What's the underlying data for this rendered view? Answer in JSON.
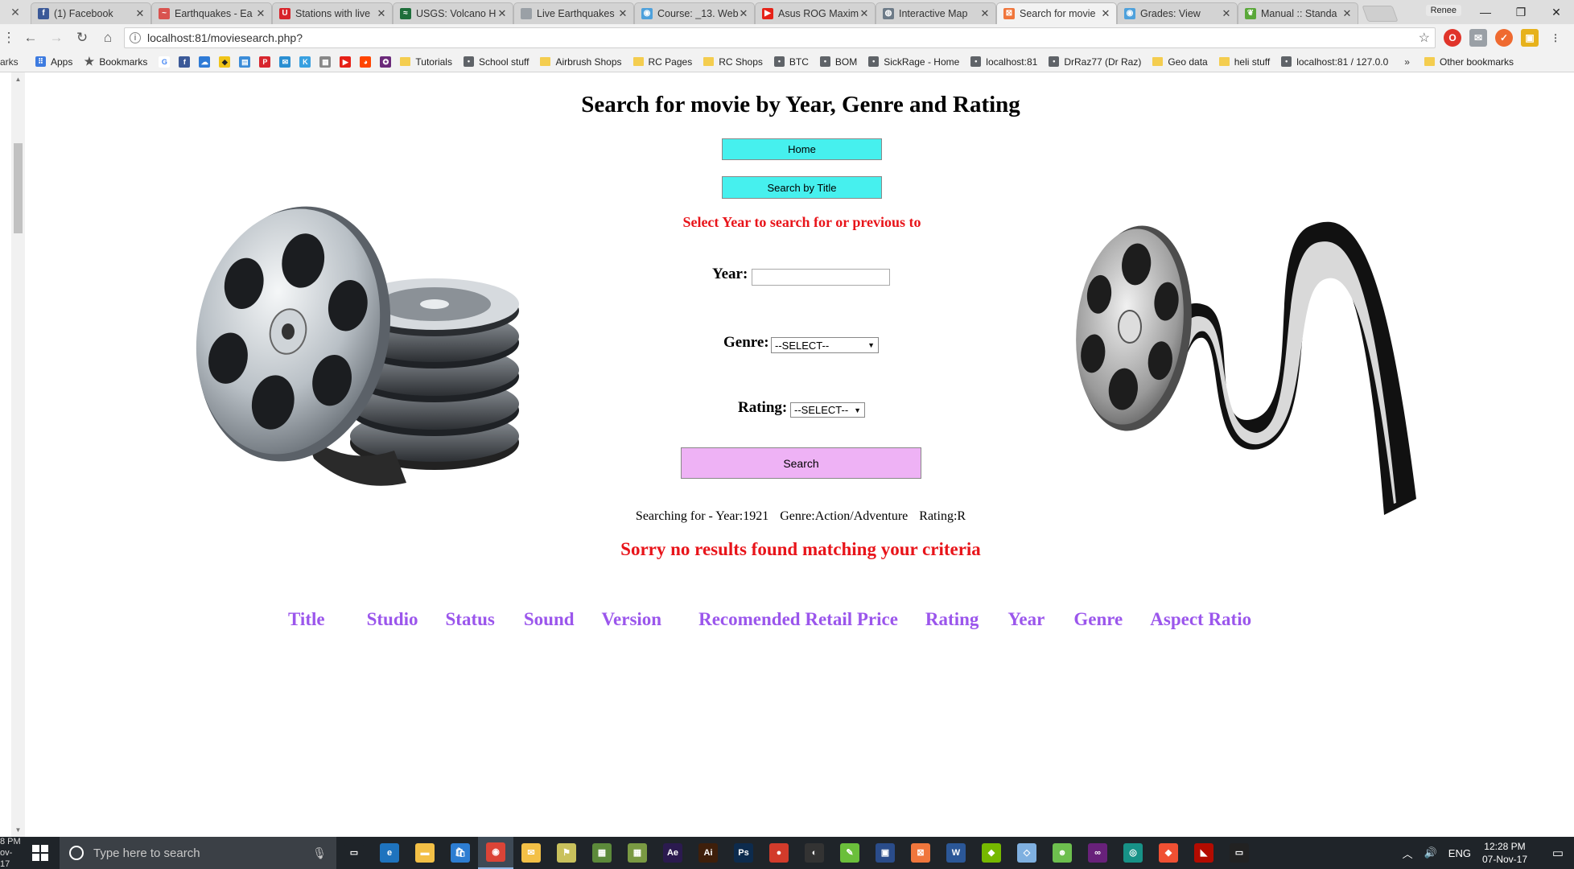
{
  "browser": {
    "left_cut_label": "",
    "tabs": [
      {
        "label": "(1) Facebook",
        "icon": "facebook-icon",
        "color": "#3b5998",
        "glyph": "f"
      },
      {
        "label": "Earthquakes - Ea",
        "icon": "seismograph-icon",
        "color": "#d9534f",
        "glyph": "~"
      },
      {
        "label": "Stations with live",
        "icon": "u-shield-icon",
        "color": "#d8232a",
        "glyph": "U"
      },
      {
        "label": "USGS: Volcano H",
        "icon": "usgs-icon",
        "color": "#1e6e3a",
        "glyph": "≈"
      },
      {
        "label": "Live Earthquakes",
        "icon": "page-icon",
        "color": "#9aa0a6",
        "glyph": ""
      },
      {
        "label": "Course: _13. Web",
        "icon": "moodle-icon",
        "color": "#4ea1dc",
        "glyph": "◉"
      },
      {
        "label": "Asus ROG Maxim",
        "icon": "youtube-icon",
        "color": "#e62117",
        "glyph": "▶"
      },
      {
        "label": "Interactive Map",
        "icon": "globe-icon",
        "color": "#6d7b88",
        "glyph": "◍"
      },
      {
        "label": "Search for movie",
        "icon": "xampp-icon",
        "color": "#f0763c",
        "glyph": "⊠"
      },
      {
        "label": "Grades: View",
        "icon": "moodle-icon",
        "color": "#4ea1dc",
        "glyph": "◉"
      },
      {
        "label": "Manual :: Standa",
        "icon": "leaf-icon",
        "color": "#5aa839",
        "glyph": "❦"
      }
    ],
    "profile_name": "Renee",
    "url": "localhost:81/moviesearch.php?",
    "bookmarks": {
      "apps": "Apps",
      "bookmarks": "Bookmarks",
      "items": [
        "Tutorials",
        "School stuff",
        "Airbrush Shops",
        "RC Pages",
        "RC Shops",
        "BTC",
        "BOM",
        "SickRage - Home",
        "localhost:81",
        "DrRaz77 (Dr Raz)",
        "Geo data",
        "heli stuff",
        "localhost:81 / 127.0.0"
      ],
      "more": "»",
      "other": "Other bookmarks"
    }
  },
  "page": {
    "title": "Search for movie by Year, Genre and Rating",
    "home_button": "Home",
    "search_by_title_button": "Search by Title",
    "instruction": "Select Year to search for or previous to",
    "year_label": "Year:",
    "year_value": "",
    "genre_label": "Genre:",
    "genre_selected": "--SELECT--",
    "rating_label": "Rating:",
    "rating_selected": "--SELECT--",
    "search_button": "Search",
    "searching_prefix": "Searching for - Year:1921",
    "searching_genre": "Genre:Action/Adventure",
    "searching_rating": "Rating:R",
    "no_results": "Sorry no results found matching your criteria",
    "columns": [
      "Title",
      "Studio",
      "Status",
      "Sound",
      "Version",
      "Recomended Retail Price",
      "Rating",
      "Year",
      "Genre",
      "Aspect Ratio"
    ]
  },
  "taskbar": {
    "left_time_top": "8 PM",
    "left_time_bottom": "ov-17",
    "search_placeholder": "Type here to search",
    "language": "ENG",
    "time": "12:28 PM",
    "date": "07-Nov-17"
  },
  "colors": {
    "accent_cyan": "#46f0ee",
    "accent_pink": "#eeb2f5",
    "error_red": "#e8141a",
    "header_purple": "#9b56ec"
  }
}
